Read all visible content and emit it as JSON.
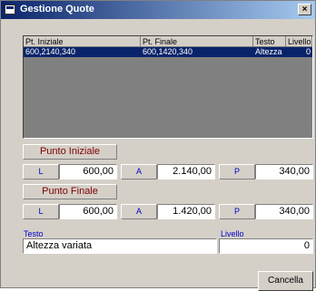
{
  "window": {
    "title": "Gestione Quote",
    "close_glyph": "×"
  },
  "list": {
    "columns": [
      "Pt. Iniziale",
      "Pt. Finale",
      "Testo",
      "Livello"
    ],
    "rows": [
      [
        "600,2140,340",
        "600,1420,340",
        "Altezza",
        "0"
      ]
    ]
  },
  "punto_iniziale": {
    "header": "Punto Iniziale",
    "l_label": "L",
    "l_value": "600,00",
    "a_label": "A",
    "a_value": "2.140,00",
    "p_label": "P",
    "p_value": "340,00"
  },
  "punto_finale": {
    "header": "Punto Finale",
    "l_label": "L",
    "l_value": "600,00",
    "a_label": "A",
    "a_value": "1.420,00",
    "p_label": "P",
    "p_value": "340,00"
  },
  "testo": {
    "label": "Testo",
    "value": "Altezza variata"
  },
  "livello": {
    "label": "Livello",
    "value": "0"
  },
  "buttons": {
    "cancel": "Cancella"
  }
}
